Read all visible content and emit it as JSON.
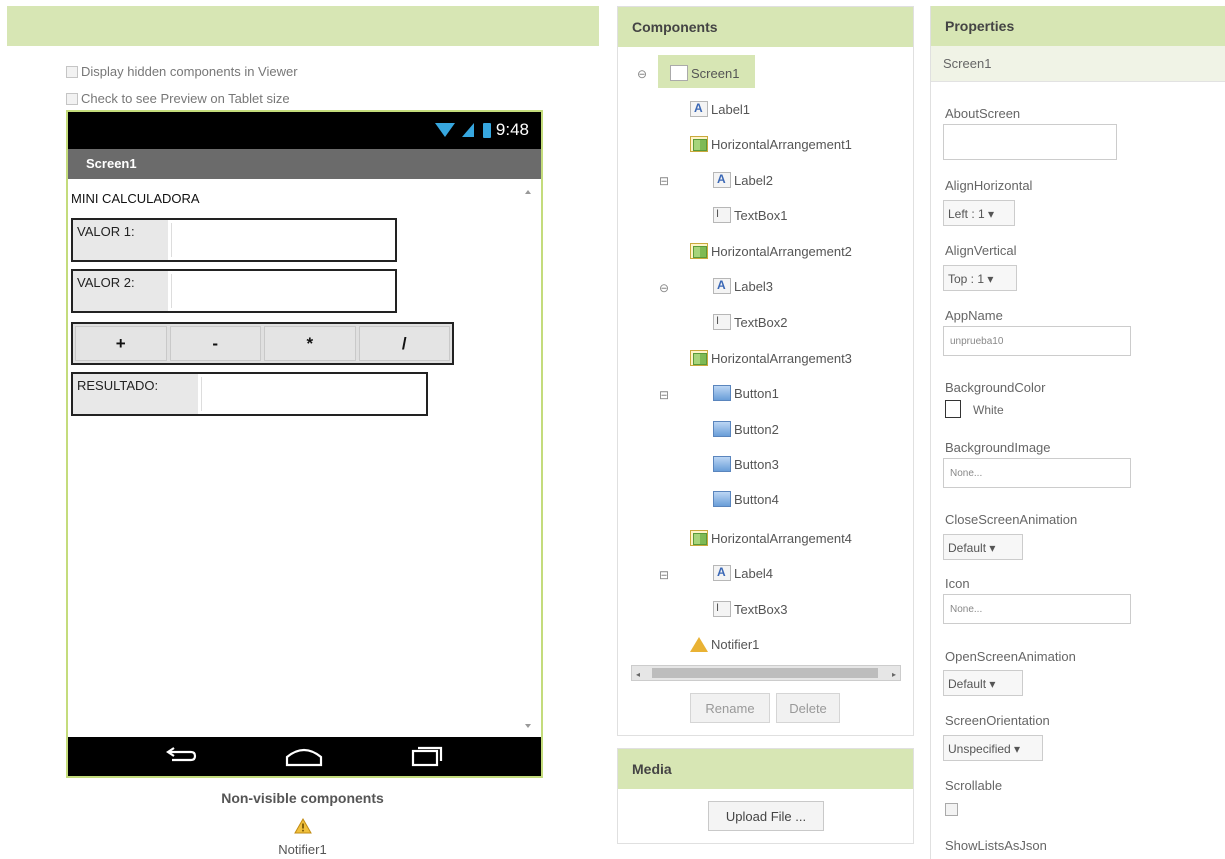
{
  "viewer": {
    "display_hidden_label": "Display hidden components in Viewer",
    "tablet_preview_label": "Check to see Preview on Tablet size",
    "phone": {
      "time": "9:48",
      "screen_title": "Screen1",
      "app_label": "MINI CALCULADORA",
      "valor1_label": "VALOR 1:",
      "valor2_label": "VALOR 2:",
      "buttons": [
        "+",
        "-",
        "*",
        "/"
      ],
      "resultado_label": "RESULTADO:"
    },
    "nonvisible_title": "Non-visible components",
    "nonvisible_item": "Notifier1"
  },
  "components": {
    "header": "Components",
    "tree": [
      {
        "label": "Screen1",
        "icon": "screen-icon",
        "level": 0
      },
      {
        "label": "Label1",
        "icon": "label-icon",
        "level": 1
      },
      {
        "label": "HorizontalArrangement1",
        "icon": "horizontal-arrangement-icon",
        "level": 1
      },
      {
        "label": "Label2",
        "icon": "label-icon",
        "level": 2
      },
      {
        "label": "TextBox1",
        "icon": "textbox-icon",
        "level": 2
      },
      {
        "label": "HorizontalArrangement2",
        "icon": "horizontal-arrangement-icon",
        "level": 1
      },
      {
        "label": "Label3",
        "icon": "label-icon",
        "level": 2
      },
      {
        "label": "TextBox2",
        "icon": "textbox-icon",
        "level": 2
      },
      {
        "label": "HorizontalArrangement3",
        "icon": "horizontal-arrangement-icon",
        "level": 1
      },
      {
        "label": "Button1",
        "icon": "button-icon",
        "level": 2
      },
      {
        "label": "Button2",
        "icon": "button-icon",
        "level": 2
      },
      {
        "label": "Button3",
        "icon": "button-icon",
        "level": 2
      },
      {
        "label": "Button4",
        "icon": "button-icon",
        "level": 2
      },
      {
        "label": "HorizontalArrangement4",
        "icon": "horizontal-arrangement-icon",
        "level": 1
      },
      {
        "label": "Label4",
        "icon": "label-icon",
        "level": 2
      },
      {
        "label": "TextBox3",
        "icon": "textbox-icon",
        "level": 2
      },
      {
        "label": "Notifier1",
        "icon": "notifier-warning-icon",
        "level": 1
      }
    ],
    "rename_label": "Rename",
    "delete_label": "Delete"
  },
  "media": {
    "header": "Media",
    "upload_label": "Upload File ..."
  },
  "properties": {
    "header": "Properties",
    "target": "Screen1",
    "about_screen": {
      "name": "AboutScreen",
      "value": ""
    },
    "align_horizontal": {
      "name": "AlignHorizontal",
      "value": "Left : 1 ▾"
    },
    "align_vertical": {
      "name": "AlignVertical",
      "value": "Top : 1 ▾"
    },
    "app_name": {
      "name": "AppName",
      "value": "unprueba10"
    },
    "background_color": {
      "name": "BackgroundColor",
      "value": "White"
    },
    "background_image": {
      "name": "BackgroundImage",
      "value": "None..."
    },
    "close_screen_animation": {
      "name": "CloseScreenAnimation",
      "value": "Default ▾"
    },
    "icon": {
      "name": "Icon",
      "value": "None..."
    },
    "open_screen_animation": {
      "name": "OpenScreenAnimation",
      "value": "Default ▾"
    },
    "screen_orientation": {
      "name": "ScreenOrientation",
      "value": "Unspecified ▾"
    },
    "scrollable": {
      "name": "Scrollable"
    },
    "show_lists_as_json": {
      "name": "ShowListsAsJson"
    }
  },
  "colors": {
    "header_green": "#d7e6b4",
    "phone_border": "#c4dc7c",
    "status_icon_blue": "#37a7df"
  }
}
